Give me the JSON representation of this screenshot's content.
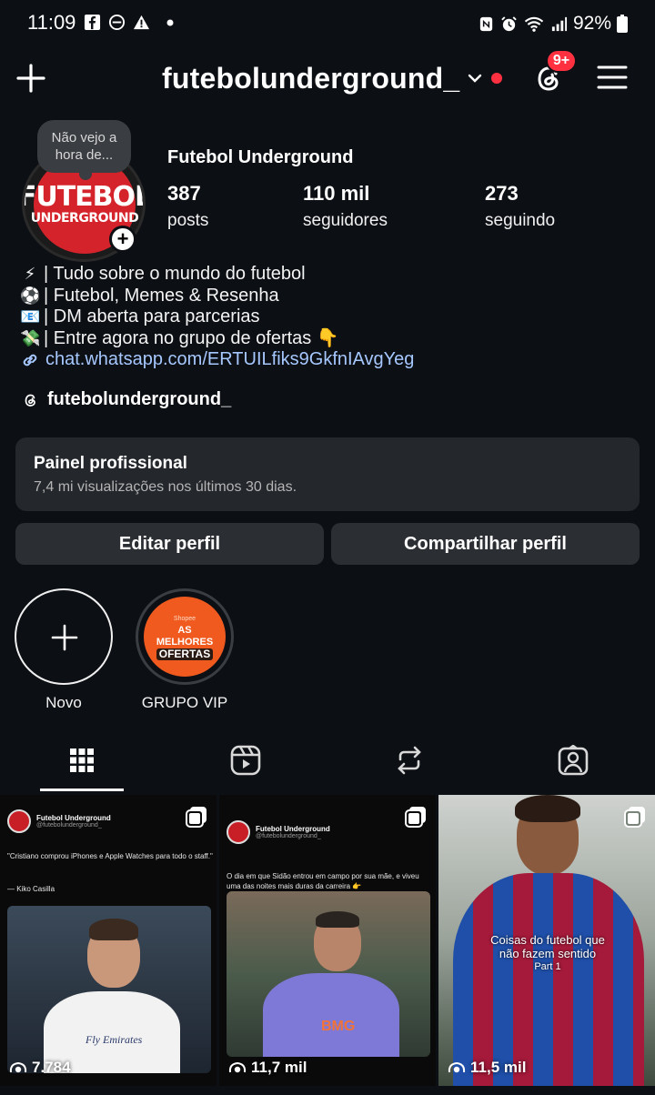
{
  "status_bar": {
    "time": "11:09",
    "battery": "92%",
    "left_icons": [
      "facebook-icon",
      "do-not-disturb-icon",
      "warning-icon",
      "dot-icon"
    ],
    "right_icons": [
      "nfc-icon",
      "alarm-icon",
      "wifi-icon",
      "signal-icon",
      "battery-icon"
    ]
  },
  "header": {
    "username": "futebolunderground_",
    "notification_badge": "9+",
    "accent_color": "#ff3040"
  },
  "profile": {
    "note": "Não vejo a hora de...",
    "avatar_text_top": "FUTEBOL",
    "avatar_text_bottom": "UNDERGROUND",
    "display_name": "Futebol Underground",
    "stats": [
      {
        "value": "387",
        "label": "posts"
      },
      {
        "value": "110 mil",
        "label": "seguidores"
      },
      {
        "value": "273",
        "label": "seguindo"
      }
    ],
    "bio": [
      {
        "emoji": "⚡",
        "text": "| Tudo sobre o mundo do futebol"
      },
      {
        "emoji": "⚽",
        "text": "| Futebol, Memes & Resenha"
      },
      {
        "emoji": "📧",
        "text": "| DM aberta para parcerias"
      },
      {
        "emoji": "💸",
        "text": "| Entre agora no grupo de ofertas 👇"
      }
    ],
    "link": "chat.whatsapp.com/ERTUILfiks9GkfnIAvgYeg",
    "threads_handle": "futebolunderground_"
  },
  "pro_panel": {
    "title": "Painel profissional",
    "subtitle": "7,4 mi visualizações nos últimos 30 dias."
  },
  "buttons": {
    "edit": "Editar perfil",
    "share": "Compartilhar perfil"
  },
  "highlights": [
    {
      "label": "Novo"
    },
    {
      "label": "GRUPO VIP",
      "art_text_1": "AS",
      "art_text_2": "MELHORES",
      "art_text_3": "OFERTAS",
      "art_brand": "Shopee"
    }
  ],
  "tabs": [
    "grid-icon",
    "reels-icon",
    "reposts-icon",
    "tagged-icon"
  ],
  "posts": [
    {
      "views": "7.784",
      "author": "Futebol Underground",
      "handle": "@futebolunderground_",
      "text": "\"Cristiano comprou iPhones e Apple Watches para todo o staff.\"",
      "text2": "— Kiko Casilla",
      "shirt_text": "Fly Emirates"
    },
    {
      "views": "11,7 mil",
      "author": "Futebol Underground",
      "handle": "@futebolunderground_",
      "text": "O dia em que Sidão entrou em campo por sua mãe, e viveu uma das noites mais duras da carreira 👉",
      "shirt_text": "BMG"
    },
    {
      "views": "11,5 mil",
      "caption": "Coisas do futebol que não fazem sentido",
      "caption2": "Part 1"
    }
  ]
}
